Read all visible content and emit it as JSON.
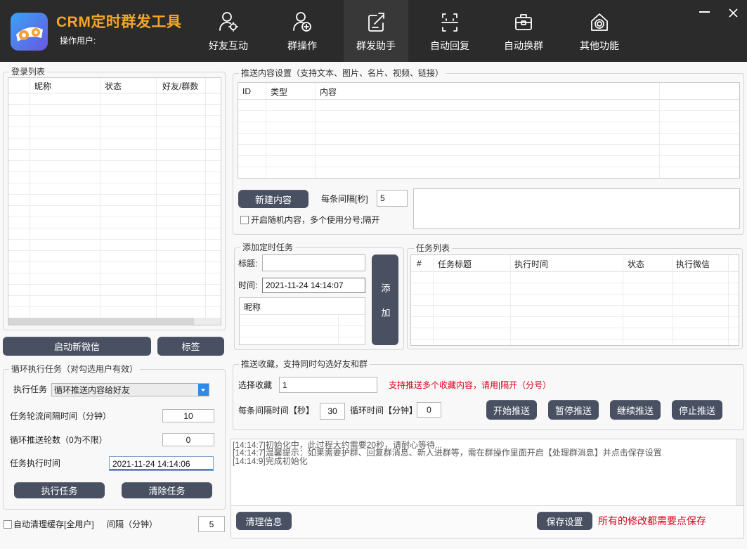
{
  "app": {
    "title": "CRM定时群发工具",
    "operator_label": "操作用户:",
    "logo_icon": "app-logo-icon"
  },
  "window_controls": {
    "minimize_icon": "minimize-icon",
    "close_icon": "close-icon"
  },
  "colors": {
    "header_bg": "#2b2b2b",
    "title": "#f5a623",
    "button": "#485062",
    "accent": "#2f8ae6",
    "warning_text": "#d9001b"
  },
  "nav": {
    "items": [
      {
        "label": "好友互动",
        "icon": "user-gear-icon",
        "active": false
      },
      {
        "label": "群操作",
        "icon": "group-add-icon",
        "active": false
      },
      {
        "label": "群发助手",
        "icon": "send-edit-icon",
        "active": true
      },
      {
        "label": "自动回复",
        "icon": "auto-reply-icon",
        "active": false
      },
      {
        "label": "自动换群",
        "icon": "toolbox-icon",
        "active": false
      },
      {
        "label": "其他功能",
        "icon": "settings-house-icon",
        "active": false
      }
    ]
  },
  "login_list": {
    "title": "登录列表",
    "columns": [
      "昵称",
      "状态",
      "好友/群数"
    ],
    "rows": []
  },
  "account_buttons": {
    "start_wechat": "启动新微信",
    "tags": "标签"
  },
  "loop_task": {
    "title": "循环执行任务（对勾选用户有效）",
    "task_label": "执行任务",
    "task_selected": "循环推送内容给好友",
    "interval_label": "任务轮流间隔时间（分钟）",
    "interval_value": "10",
    "rounds_label": "循环推送轮数（0为不限）",
    "rounds_value": "0",
    "time_label": "任务执行时间",
    "time_value": "2021-11-24 14:14:06",
    "run_button": "执行任务",
    "clear_button": "清除任务"
  },
  "cache": {
    "checkbox_label": "自动清理缓存[全用户]",
    "checked": false,
    "interval_label": "间隔（分钟）",
    "interval_value": "5"
  },
  "push_content": {
    "title": "推送内容设置（支持文本、图片、名片、视频、链接）",
    "columns": [
      "ID",
      "类型",
      "内容"
    ],
    "rows": [],
    "new_button": "新建内容",
    "interval_label": "每条间隔[秒]",
    "interval_value": "5",
    "random_label": "开启随机内容，多个使用分号;隔开",
    "random_checked": false,
    "text_value": ""
  },
  "schedule": {
    "title": "添加定时任务",
    "title_label": "标题:",
    "title_value": "",
    "time_label": "时间:",
    "time_value": "2021-11-24 14:14:07",
    "nick_column": "昵称",
    "add_button": "添加"
  },
  "task_list": {
    "title": "任务列表",
    "columns": [
      "#",
      "任务标题",
      "执行时间",
      "状态",
      "执行微信"
    ],
    "rows": []
  },
  "favorites": {
    "title": "推送收藏，支持同时勾选好友和群",
    "select_label": "选择收藏",
    "select_value": "1",
    "hint": "支持推送多个收藏内容，请用|隔开（分号）",
    "interval_label": "每条间隔时间【秒】",
    "interval_value": "30",
    "loop_label": "循环时间【分钟】",
    "loop_value": "0",
    "buttons": [
      "开始推送",
      "暂停推送",
      "继续推送",
      "停止推送"
    ]
  },
  "log": {
    "lines": [
      "[14:14:7]初始化中，此过程大约需要20秒，请耐心等待...",
      "[14:14:7]温馨提示：如果需要护群、回复群消息、新人进群等，需在群操作里面开启【处理群消息】并点击保存设置",
      "[14:14:9]完成初始化"
    ]
  },
  "footer": {
    "clear_button": "清理信息",
    "save_button": "保存设置",
    "save_hint": "所有的修改都需要点保存"
  }
}
